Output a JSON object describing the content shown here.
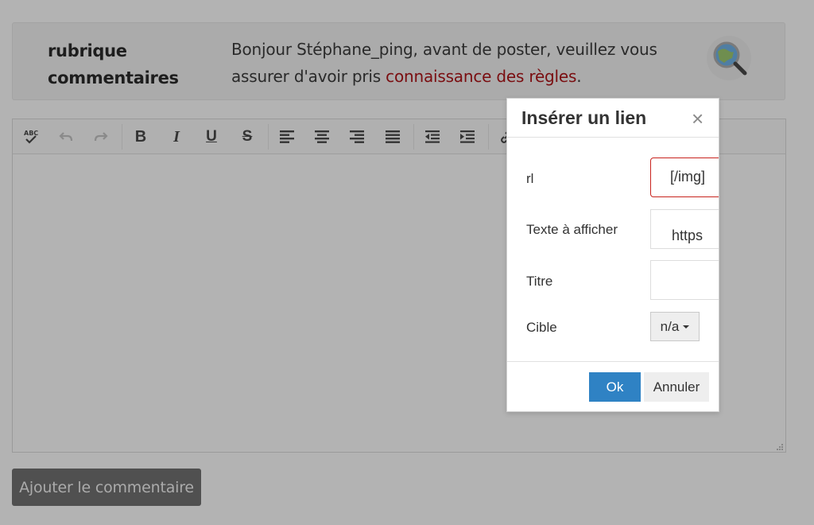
{
  "header": {
    "section_label": "rubrique commentaires",
    "greeting_prefix": "Bonjour Stéphane_ping, avant de poster, veuillez vous assurer d'avoir pris ",
    "rules_link": "connaissance des règles",
    "greeting_suffix": "."
  },
  "editor": {
    "toolbar_icons": [
      "spellcheck-icon",
      "undo-icon",
      "redo-icon",
      "bold-icon",
      "italic-icon",
      "underline-icon",
      "strikethrough-icon",
      "align-left-icon",
      "align-center-icon",
      "align-right-icon",
      "justify-icon",
      "outdent-icon",
      "indent-icon",
      "link-icon"
    ]
  },
  "submit_label": "Ajouter le commentaire",
  "dialog": {
    "title": "Insérer un lien",
    "close_glyph": "×",
    "url_label": "rl",
    "url_value": "[/img]",
    "text_label": "Texte à afficher",
    "text_value": "https",
    "title_label": "Titre",
    "title_value": "",
    "target_label": "Cible",
    "target_value": "n/a",
    "ok_label": "Ok",
    "cancel_label": "Annuler"
  },
  "colors": {
    "overlay": "#b3b3b3",
    "ok_button": "#2f82c4",
    "rules_link": "#7a0d10",
    "invalid_border": "#c8231e"
  }
}
